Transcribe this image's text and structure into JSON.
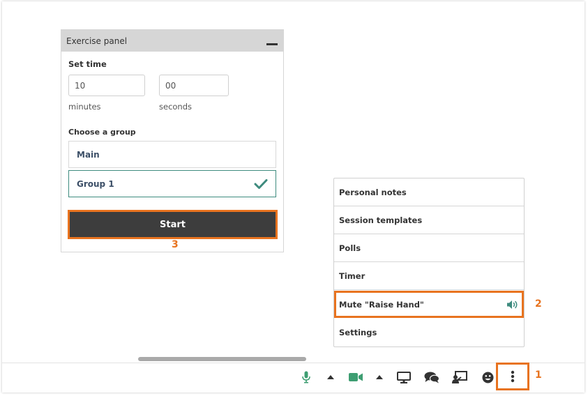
{
  "exercise_panel": {
    "title": "Exercise panel",
    "set_time_label": "Set time",
    "minutes_value": "10",
    "seconds_value": "00",
    "minutes_label": "minutes",
    "seconds_label": "seconds",
    "choose_group_label": "Choose a group",
    "groups": [
      {
        "label": "Main",
        "selected": false
      },
      {
        "label": "Group 1",
        "selected": true
      }
    ],
    "start_label": "Start"
  },
  "menu": {
    "items": [
      {
        "label": "Personal notes"
      },
      {
        "label": "Session templates"
      },
      {
        "label": "Polls"
      },
      {
        "label": "Timer"
      },
      {
        "label": "Mute \"Raise Hand\"",
        "icon": "speaker-icon"
      },
      {
        "label": "Settings"
      }
    ]
  },
  "callouts": {
    "one": "1",
    "two": "2",
    "three": "3"
  },
  "toolbar": {
    "icons": [
      "microphone-icon",
      "caret-up-icon",
      "camera-icon",
      "caret-up-icon",
      "screen-share-icon",
      "chat-icon",
      "presenter-icon",
      "emoji-icon",
      "more-vertical-icon"
    ]
  },
  "colors": {
    "accent_orange": "#e8731f",
    "green": "#3e8b7e",
    "dark_button": "#3d3d3d",
    "header_gray": "#d6d6d6"
  }
}
